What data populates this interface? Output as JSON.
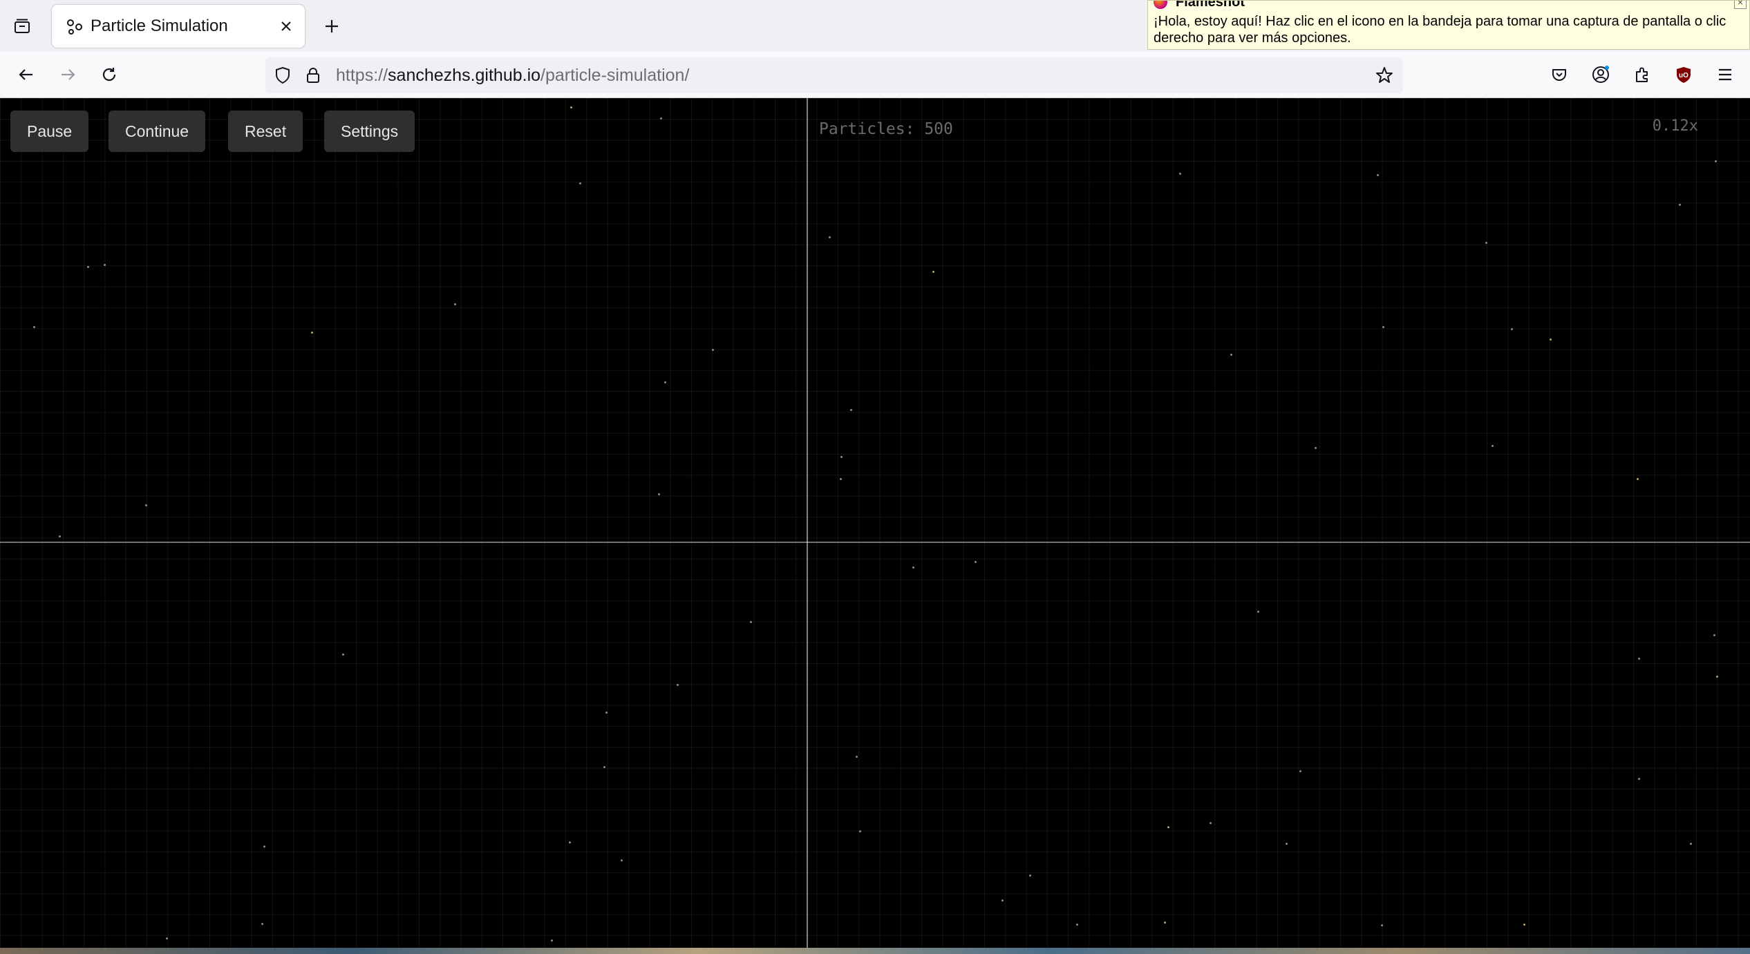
{
  "browser": {
    "tab": {
      "title": "Particle Simulation",
      "favicon": "particles-icon"
    },
    "url": {
      "domain": "sanchezhs.github.io",
      "path": "/particle-simulation/",
      "scheme": "https://"
    }
  },
  "notification": {
    "app": "Flameshot",
    "message": "¡Hola, estoy aquí! Haz clic en el icono en la bandeja para tomar una captura de pantalla o clic derecho para ver más opciones."
  },
  "simulation": {
    "controls": {
      "pause_label": "Pause",
      "continue_label": "Continue",
      "reset_label": "Reset",
      "settings_label": "Settings"
    },
    "particle_count_text": "Particles: 500",
    "zoom_text": "0.12x"
  },
  "colors": {
    "background": "#000000",
    "button_bg": "#2f2f2f",
    "notification_bg": "#ffffe1"
  }
}
